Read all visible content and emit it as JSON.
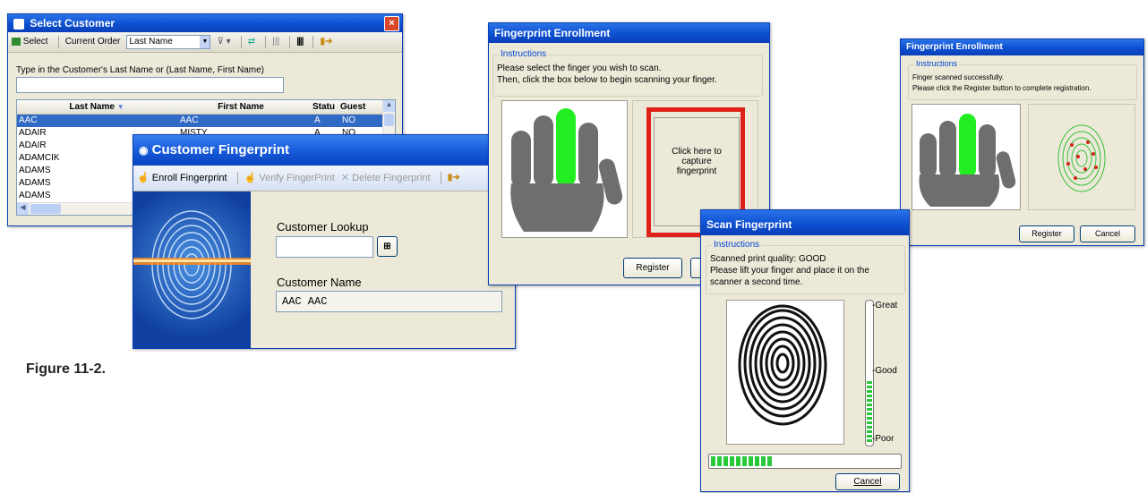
{
  "caption": "Figure 11-2.",
  "select_customer": {
    "title": "Select Customer",
    "close_label": "×",
    "toolbar": {
      "select": "Select",
      "current_order_label": "Current Order",
      "order_value": "Last Name"
    },
    "instruction": "Type in the Customer's Last Name or (Last Name, First Name)",
    "search_value": "",
    "columns": [
      "Last Name",
      "First Name",
      "Statu",
      "Guest"
    ],
    "rows": [
      {
        "last": "AAC",
        "first": "AAC",
        "status": "A",
        "guest": "NO",
        "selected": true
      },
      {
        "last": "ADAIR",
        "first": "MISTY",
        "status": "A",
        "guest": "NO",
        "selected": false
      },
      {
        "last": "ADAIR",
        "first": "",
        "status": "",
        "guest": "",
        "selected": false
      },
      {
        "last": "ADAMCIK",
        "first": "",
        "status": "",
        "guest": "",
        "selected": false
      },
      {
        "last": "ADAMS",
        "first": "",
        "status": "",
        "guest": "",
        "selected": false
      },
      {
        "last": "ADAMS",
        "first": "",
        "status": "",
        "guest": "",
        "selected": false
      },
      {
        "last": "ADAMS",
        "first": "",
        "status": "",
        "guest": "",
        "selected": false
      }
    ]
  },
  "customer_fingerprint": {
    "title": "Customer Fingerprint",
    "toolbar": {
      "enroll": "Enroll Fingerprint",
      "verify": "Verify FingerPrint",
      "delete": "Delete Fingerprint"
    },
    "lookup_label": "Customer Lookup",
    "lookup_value": "",
    "name_label": "Customer Name",
    "name_value": "AAC AAC"
  },
  "enrollment": {
    "title": "Fingerprint Enrollment",
    "instructions_legend": "Instructions",
    "line1": "Please select the finger you wish to scan.",
    "line2": "Then, click the box below to begin scanning your finger.",
    "capture_line1": "Click here to",
    "capture_line2": "capture",
    "capture_line3": "fingerprint",
    "register": "Register",
    "highlight_color": "#e0201b",
    "selected_finger_color": "#22ee22"
  },
  "enrollment_done": {
    "title": "Fingerprint Enrollment",
    "instructions_legend": "Instructions",
    "line1": "Finger scanned successfully.",
    "line2": "Please click the Register button to complete registration.",
    "register": "Register",
    "cancel": "Cancel"
  },
  "scan": {
    "title": "Scan Fingerprint",
    "instructions_legend": "Instructions",
    "line1": "Scanned print quality: GOOD",
    "line2": "Please lift your finger and place it on the",
    "line3": "scanner a second time.",
    "great": "-Great",
    "good": "-Good",
    "poor": "-Poor",
    "quality_level": 0.45,
    "progress_blocks": 10,
    "cancel": "Cancel"
  }
}
